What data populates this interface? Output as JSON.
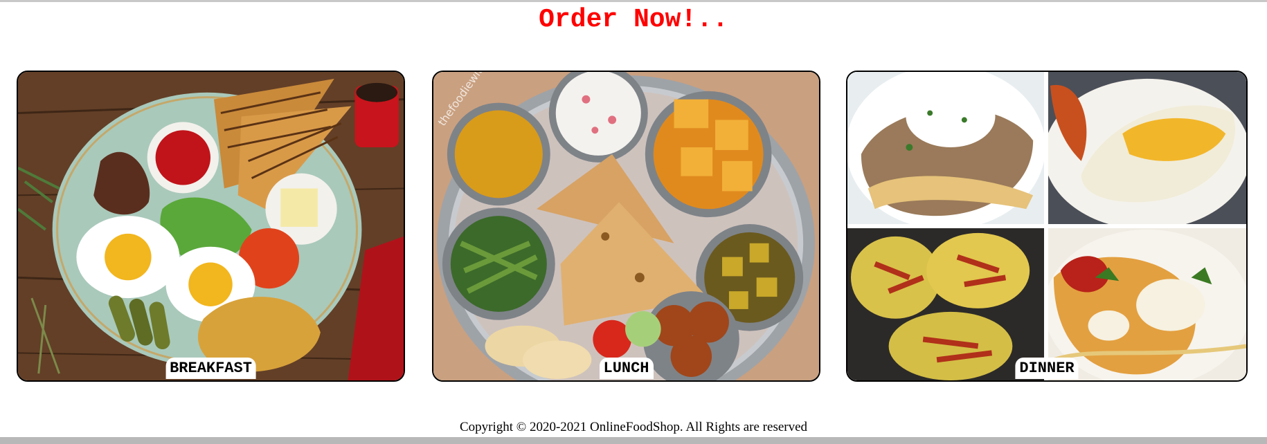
{
  "page": {
    "title": "Order Now!..",
    "title_color": "#ff0000"
  },
  "cards": [
    {
      "label": "BREAKFAST",
      "image": "breakfast-plate"
    },
    {
      "label": "LUNCH",
      "image": "indian-thali"
    },
    {
      "label": "DINNER",
      "image": "dinner-collage"
    }
  ],
  "footer": {
    "copyright": "Copyright © 2020-2021 OnlineFoodShop. All Rights are reserved"
  }
}
